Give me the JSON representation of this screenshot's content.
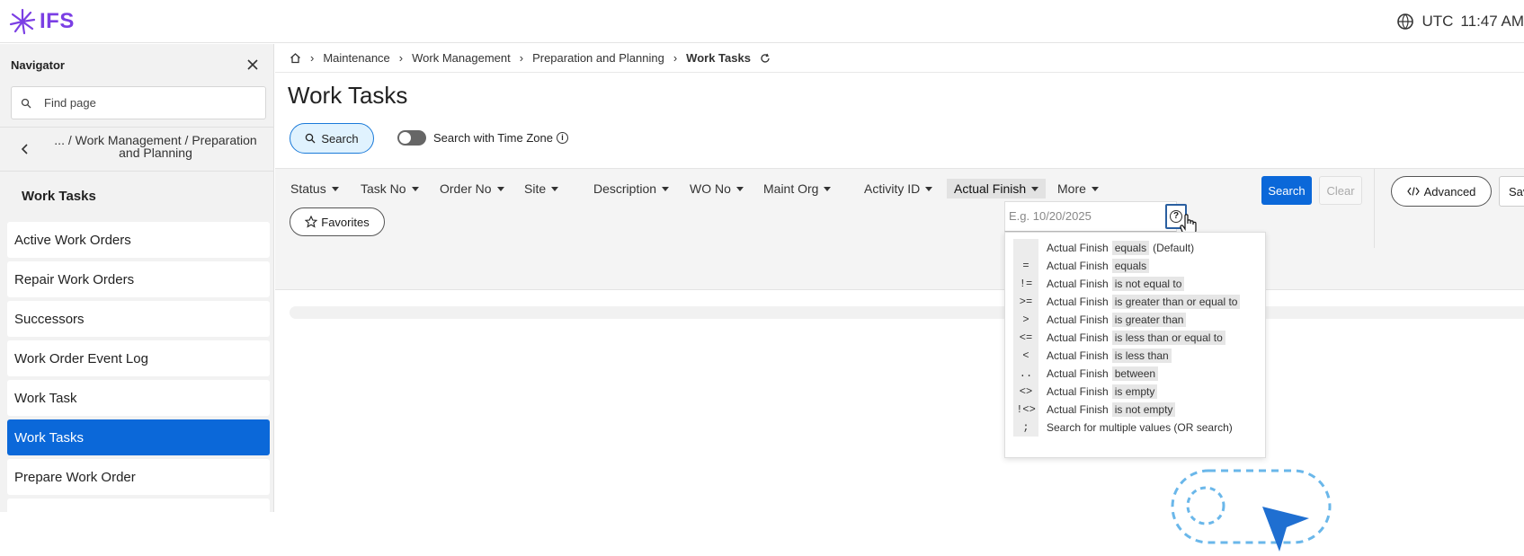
{
  "app": {
    "logo_text": "IFS",
    "timezone": "UTC",
    "time": "11:47 AM"
  },
  "navigator": {
    "title": "Navigator",
    "search_placeholder": "Find page",
    "crumb": "... / Work Management / Preparation and Planning",
    "section": "Work Tasks",
    "items": [
      {
        "label": "Active Work Orders",
        "active": false
      },
      {
        "label": "Repair Work Orders",
        "active": false
      },
      {
        "label": "Successors",
        "active": false
      },
      {
        "label": "Work Order Event Log",
        "active": false
      },
      {
        "label": "Work Task",
        "active": false
      },
      {
        "label": "Work Tasks",
        "active": true
      },
      {
        "label": "Prepare Work Order",
        "active": false
      }
    ]
  },
  "breadcrumb": {
    "items": [
      "Maintenance",
      "Work Management",
      "Preparation and Planning"
    ],
    "current": "Work Tasks"
  },
  "page": {
    "title": "Work Tasks",
    "search_button": "Search",
    "timezone_toggle_label": "Search with Time Zone"
  },
  "filters": {
    "items": [
      "Status",
      "Task No",
      "Order No",
      "Site",
      "Description",
      "WO No",
      "Maint Org",
      "Activity ID",
      "Actual Finish",
      "More"
    ],
    "active": "Actual Finish",
    "search_button": "Search",
    "clear_button": "Clear",
    "advanced_button": "Advanced",
    "save_button": "Save",
    "favorites_button": "Favorites"
  },
  "popup": {
    "input_placeholder": "E.g. 10/20/2025",
    "field": "Actual Finish",
    "operators": [
      {
        "symbol": "",
        "word": "equals",
        "extra": "(Default)"
      },
      {
        "symbol": "=",
        "word": "equals",
        "extra": ""
      },
      {
        "symbol": "!=",
        "word": "is not equal to",
        "extra": ""
      },
      {
        "symbol": ">=",
        "word": "is greater than or equal to",
        "extra": ""
      },
      {
        "symbol": ">",
        "word": "is greater than",
        "extra": ""
      },
      {
        "symbol": "<=",
        "word": "is less than or equal to",
        "extra": ""
      },
      {
        "symbol": "<",
        "word": "is less than",
        "extra": ""
      },
      {
        "symbol": "..",
        "word": "between",
        "extra": ""
      },
      {
        "symbol": "<>",
        "word": "is empty",
        "extra": ""
      },
      {
        "symbol": "!<>",
        "word": "is not empty",
        "extra": ""
      }
    ],
    "or_symbol": ";",
    "or_text": "Search for multiple values (OR search)"
  },
  "colors": {
    "brand": "#7b3fe4",
    "primary": "#0b68d9",
    "search_bg": "#e0f2fe"
  }
}
